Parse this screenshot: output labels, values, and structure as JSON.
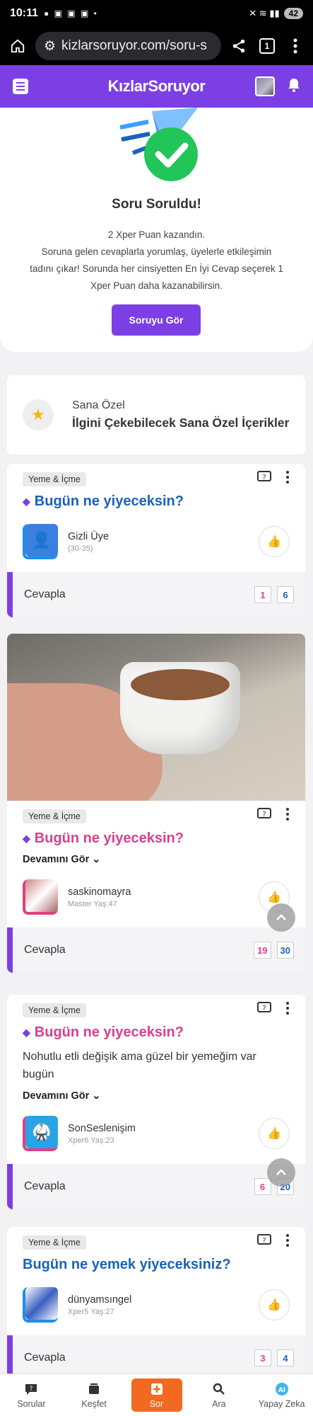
{
  "status": {
    "time": "10:11",
    "battery": "42"
  },
  "browser": {
    "url": "kizlarsoruyor.com/soru-s",
    "tabs": "1"
  },
  "header": {
    "logo": "KızlarSoruyor"
  },
  "success": {
    "title": "Soru Soruldu!",
    "line1": "2 Xper Puan kazandın.",
    "line2": "Soruna gelen cevaplarla yorumlaş, üyelerle etkileşimin tadını çıkar! Sorunda her cinsiyetten En İyi Cevap seçerek 1 Xper Puan daha kazanabilirsin.",
    "button": "Soruyu Gör"
  },
  "special": {
    "kicker": "Sana Özel",
    "title": "İlgini Çekebilecek Sana Özel İçerikler"
  },
  "cards": [
    {
      "category": "Yeme & İçme",
      "title": "Bugün ne yiyeceksin?",
      "user": "Gizli Üye",
      "meta": "(30-35)",
      "answer": "Cevapla",
      "count_pink": "1",
      "count_blue": "6"
    },
    {
      "category": "Yeme & İçme",
      "title": "Bugün ne yiyeceksin?",
      "more": "Devamını Gör",
      "user": "saskinomayra",
      "meta": "Master Yaş:47",
      "answer": "Cevapla",
      "count_pink": "19",
      "count_blue": "30"
    },
    {
      "category": "Yeme & İçme",
      "title": "Bugün ne yiyeceksin?",
      "body": "Nohutlu etli değişik ama güzel bir yemeğim var bugün",
      "more": "Devamını Gör",
      "user": "SonSeslenişim",
      "meta": "Xper6 Yaş:23",
      "answer": "Cevapla",
      "count_pink": "6",
      "count_blue": "20"
    },
    {
      "category": "Yeme & İçme",
      "title": "Bugün ne yemek yiyeceksiniz?",
      "user": "dünyamsıngel",
      "meta": "Xper5 Yaş:27",
      "answer": "Cevapla",
      "count_pink": "3",
      "count_blue": "4"
    }
  ],
  "nav": [
    {
      "label": "Sorular",
      "icon": "question-bubble-icon"
    },
    {
      "label": "Keşfet",
      "icon": "cards-icon"
    },
    {
      "label": "Sor",
      "icon": "plus-icon"
    },
    {
      "label": "Ara",
      "icon": "search-icon"
    },
    {
      "label": "Yapay Zeka",
      "icon": "ai-icon"
    }
  ],
  "colors": {
    "brand": "#7b3fe4",
    "pink": "#d8408c",
    "blue": "#1a62b8",
    "orange": "#f26a21"
  }
}
